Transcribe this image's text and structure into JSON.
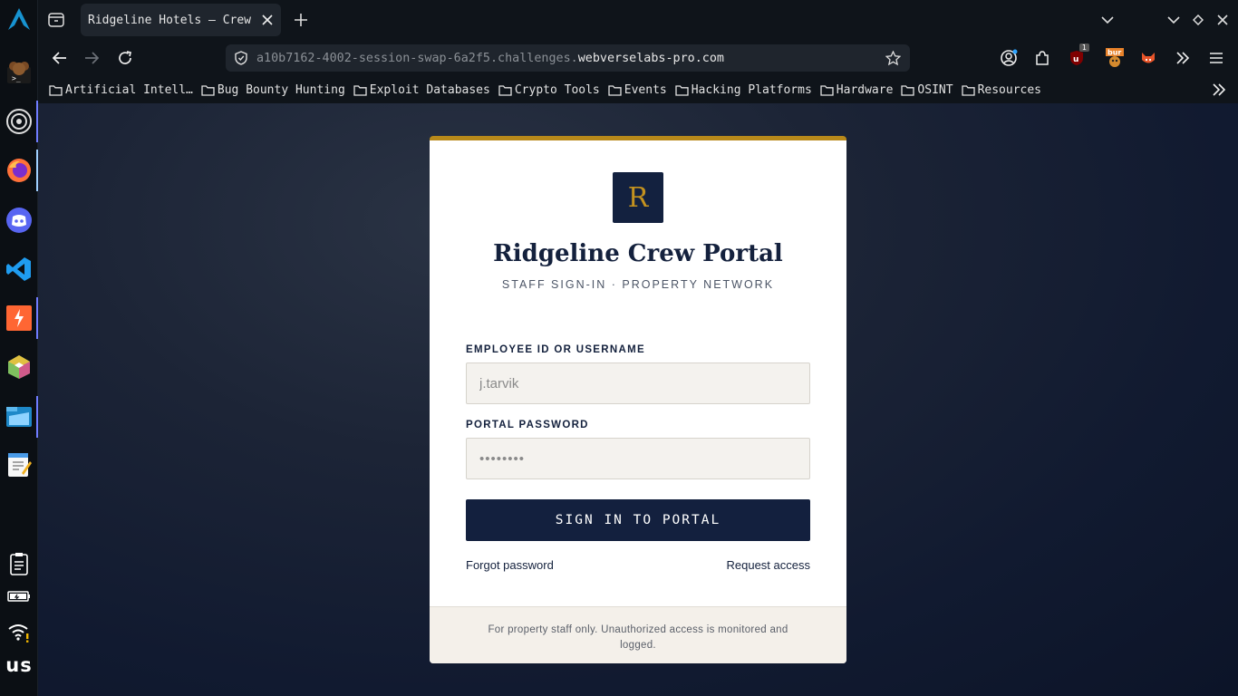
{
  "browser": {
    "tab_title": "Ridgeline Hotels — Crew",
    "url_prefix": "a10b7162-4002-session-swap-6a2f5.challenges.",
    "url_host": "webverselabs-pro.com",
    "extension_badge": "1",
    "bookmarks": [
      "Artificial Intell…",
      "Bug Bounty Hunting",
      "Exploit Databases",
      "Crypto Tools",
      "Events",
      "Hacking Platforms",
      "Hardware",
      "OSINT",
      "Resources"
    ]
  },
  "dock": {
    "keyboard_layout": "us"
  },
  "login": {
    "logo_letter": "R",
    "title": "Ridgeline Crew Portal",
    "subtitle": "STAFF SIGN-IN · PROPERTY NETWORK",
    "username_label": "EMPLOYEE ID OR USERNAME",
    "username_placeholder": "j.tarvik",
    "password_label": "PORTAL PASSWORD",
    "password_placeholder": "••••••••",
    "submit_label": "SIGN IN TO PORTAL",
    "forgot_link": "Forgot password",
    "request_link": "Request access",
    "footer_note": "For property staff only. Unauthorized access is monitored and logged."
  },
  "colors": {
    "accent_gold": "#b8891a",
    "navy": "#13203e"
  }
}
